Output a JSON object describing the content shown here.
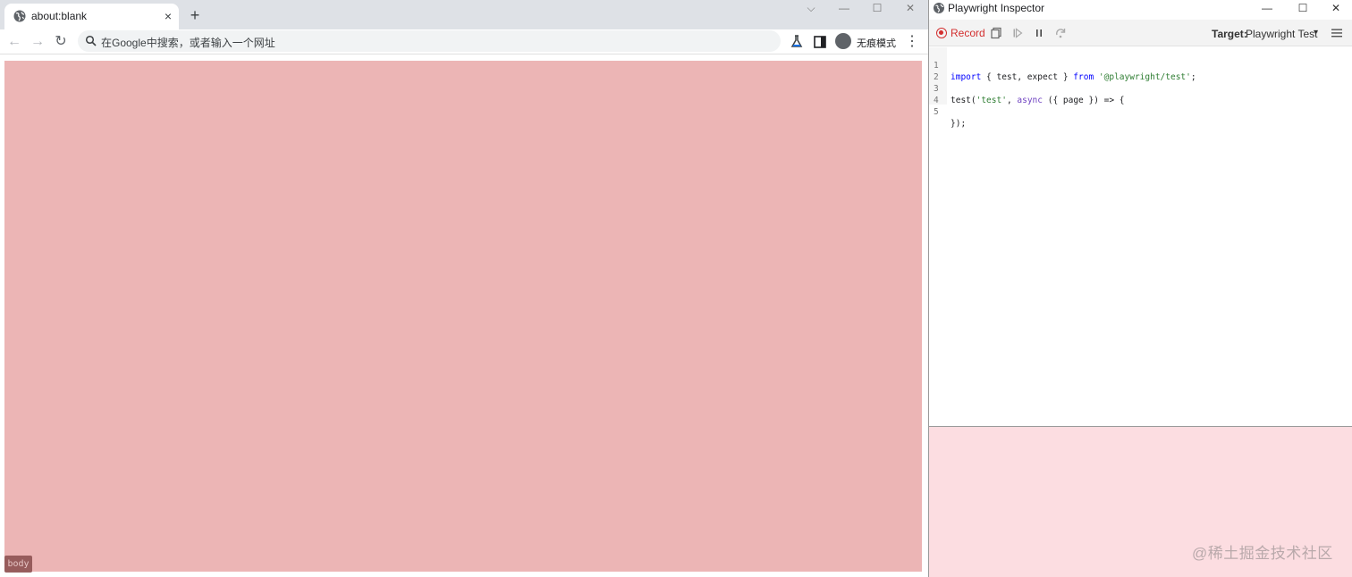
{
  "browser": {
    "tab": {
      "title": "about:blank",
      "close_glyph": "×"
    },
    "new_tab_glyph": "+",
    "window_controls": {
      "dropdown": "⌵",
      "minimize": "—",
      "maximize": "☐",
      "close": "✕"
    },
    "nav": {
      "back": "←",
      "forward": "→",
      "reload": "↻"
    },
    "omnibox": {
      "placeholder": "在Google中搜索，或者输入一个网址"
    },
    "incognito_label": "无痕模式",
    "menu_glyph": "⋮",
    "page": {
      "background": "#ecb5b5",
      "element_tag": "body"
    }
  },
  "inspector": {
    "title": "Playwright Inspector",
    "window_controls": {
      "minimize": "—",
      "maximize": "☐",
      "close": "✕"
    },
    "toolbar": {
      "record_label": "Record",
      "target_label": "Target:",
      "target_value": "Playwright Test"
    },
    "code_lines": [
      {
        "n": "1",
        "text": "import { test, expect } from '@playwright/test';"
      },
      {
        "n": "2",
        "text": ""
      },
      {
        "n": "3",
        "text": "test('test', async ({ page }) => {"
      },
      {
        "n": "4",
        "text": ""
      },
      {
        "n": "5",
        "text": "});"
      }
    ]
  },
  "watermark": "@稀土掘金技术社区",
  "colors": {
    "record_red": "#d32f2f",
    "page_pink": "#ecb5b5",
    "panel_pink": "#fcdde1"
  }
}
